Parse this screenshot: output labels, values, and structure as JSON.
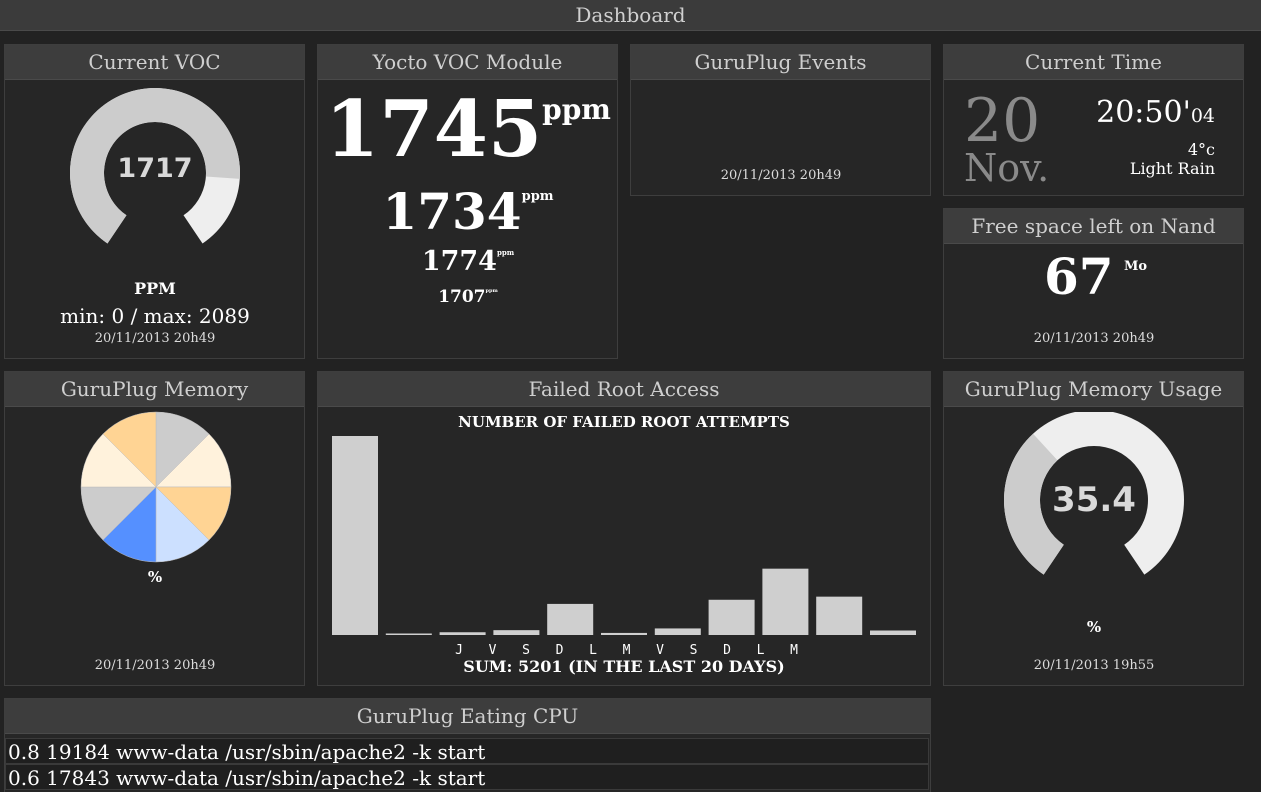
{
  "header": {
    "title": "Dashboard"
  },
  "voc_gauge": {
    "title": "Current VOC",
    "value": "1717",
    "unit": "PPM",
    "minmax": "min: 0 / max: 2089",
    "date": "20/11/2013 20h49",
    "min": 0,
    "max": 2089,
    "current": 1717
  },
  "yocto": {
    "title": "Yocto VOC Module",
    "readings": [
      {
        "value": "1745",
        "unit": "ppm"
      },
      {
        "value": "1734",
        "unit": "ppm"
      },
      {
        "value": "1774",
        "unit": "ppm"
      },
      {
        "value": "1707",
        "unit": "ppm"
      }
    ]
  },
  "events": {
    "title": "GuruPlug Events",
    "date": "20/11/2013 20h49"
  },
  "time": {
    "title": "Current Time",
    "day": "20",
    "month": "Nov.",
    "clock": "20:50'",
    "seconds": "04",
    "temperature": "4°c",
    "weather": "Light Rain"
  },
  "nand": {
    "title": "Free space left on Nand",
    "value": "67",
    "unit": "Mo",
    "date": "20/11/2013 20h49"
  },
  "memory_pie": {
    "title": "GuruPlug Memory",
    "label": "%",
    "date": "20/11/2013 20h49",
    "colors": [
      "#cccccc",
      "#fff2dc",
      "#ffd494",
      "#cce0ff",
      "#5590ff",
      "#cccccc",
      "#fff2dc",
      "#ffd494"
    ]
  },
  "failed_root": {
    "title": "Failed Root Access",
    "chart_data": {
      "type": "bar",
      "title": "NUMBER OF FAILED ROOT ATTEMPTS",
      "categories": [
        "",
        "",
        "J",
        "V",
        "S",
        "D",
        "L",
        "M",
        "V",
        "S",
        "D",
        "L",
        "M",
        ""
      ],
      "values": [
        2880,
        8,
        40,
        70,
        450,
        30,
        95,
        510,
        960,
        555,
        65
      ],
      "tick_labels": [
        "J",
        "V",
        "S",
        "D",
        "L",
        "M",
        "V",
        "S",
        "D",
        "L",
        "M"
      ],
      "ylim": [
        0,
        2880
      ],
      "grid": false,
      "bar_color": "#cccccc",
      "footer": "SUM: 5201 (IN THE LAST 20 DAYS)"
    }
  },
  "memory_usage": {
    "title": "GuruPlug Memory Usage",
    "value": "35.4",
    "unit": "%",
    "date": "20/11/2013 19h55",
    "fraction": 0.354
  },
  "cpu": {
    "title": "GuruPlug Eating CPU",
    "rows": [
      "0.8 19184 www-data /usr/sbin/apache2 -k start",
      "0.6 17843 www-data /usr/sbin/apache2 -k start"
    ]
  }
}
